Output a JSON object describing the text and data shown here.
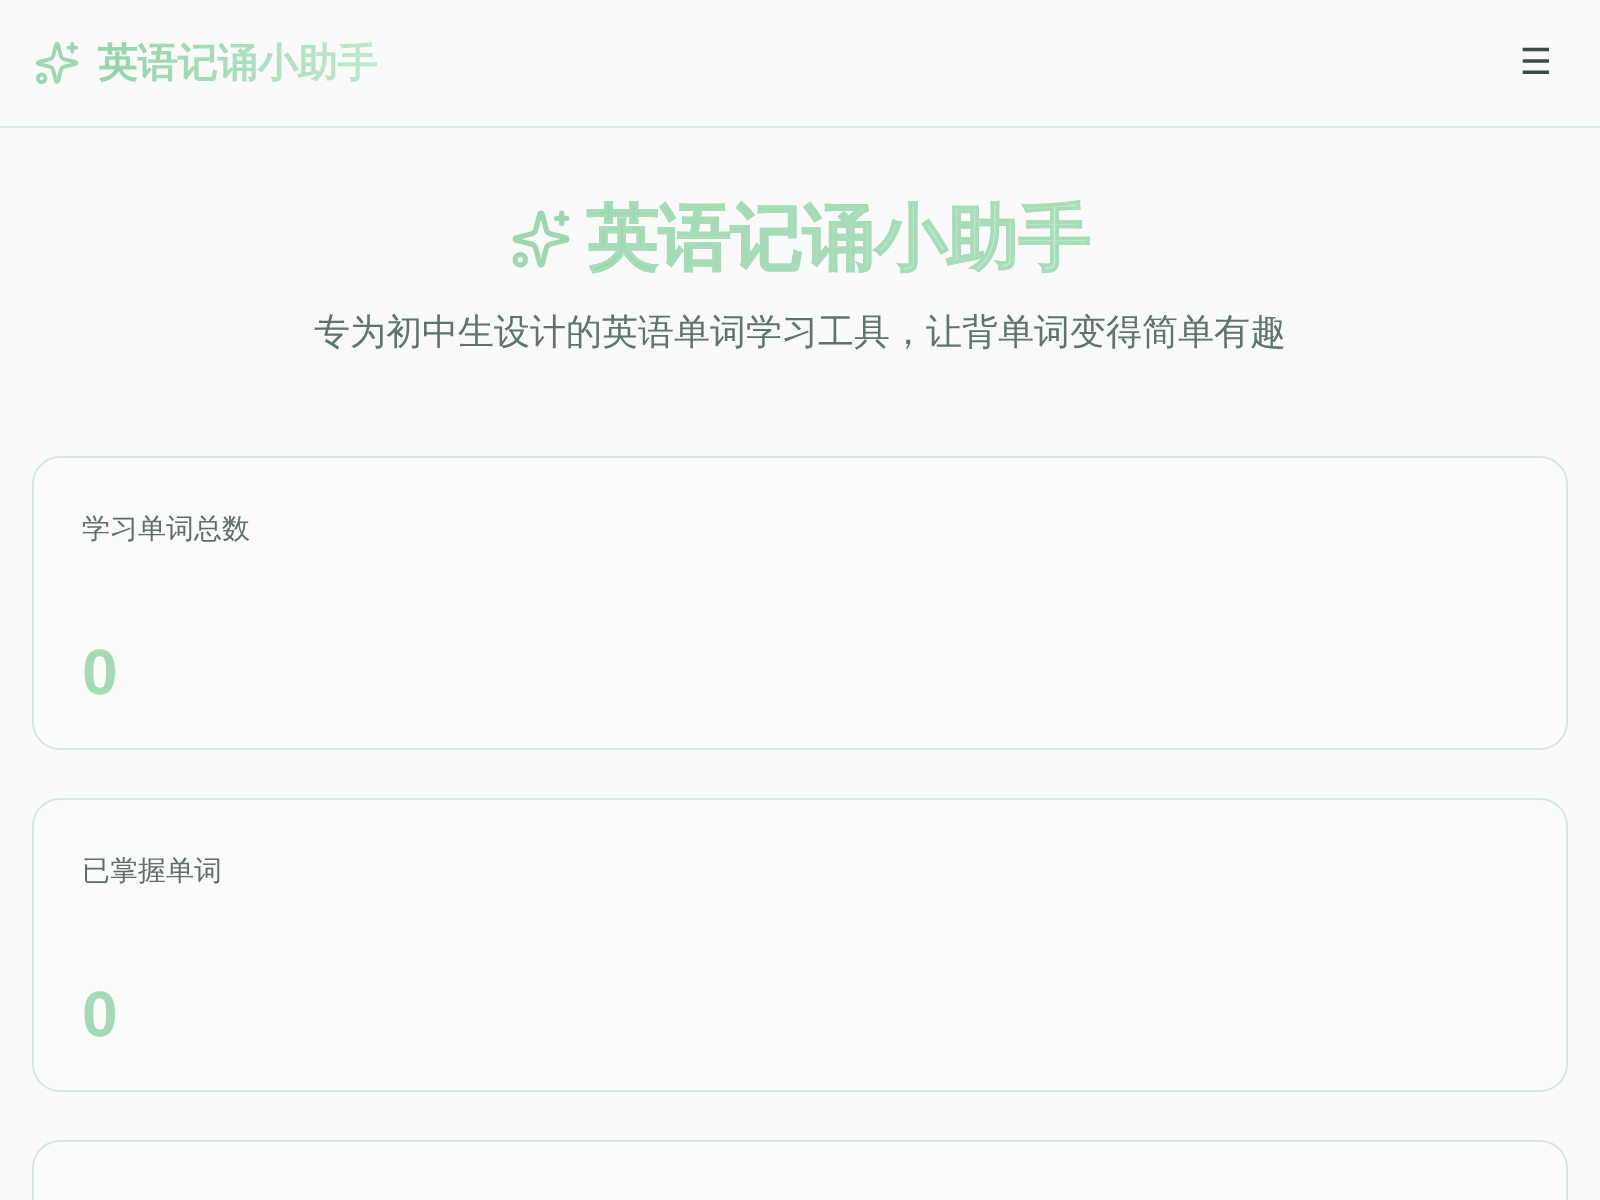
{
  "header": {
    "title": "英语记诵小助手",
    "menu_icon": "☰"
  },
  "hero": {
    "title": "英语记诵小助手",
    "subtitle": "专为初中生设计的英语单词学习工具，让背单词变得简单有趣"
  },
  "stats": [
    {
      "label": "学习单词总数",
      "value": "0"
    },
    {
      "label": "已掌握单词",
      "value": "0"
    }
  ]
}
